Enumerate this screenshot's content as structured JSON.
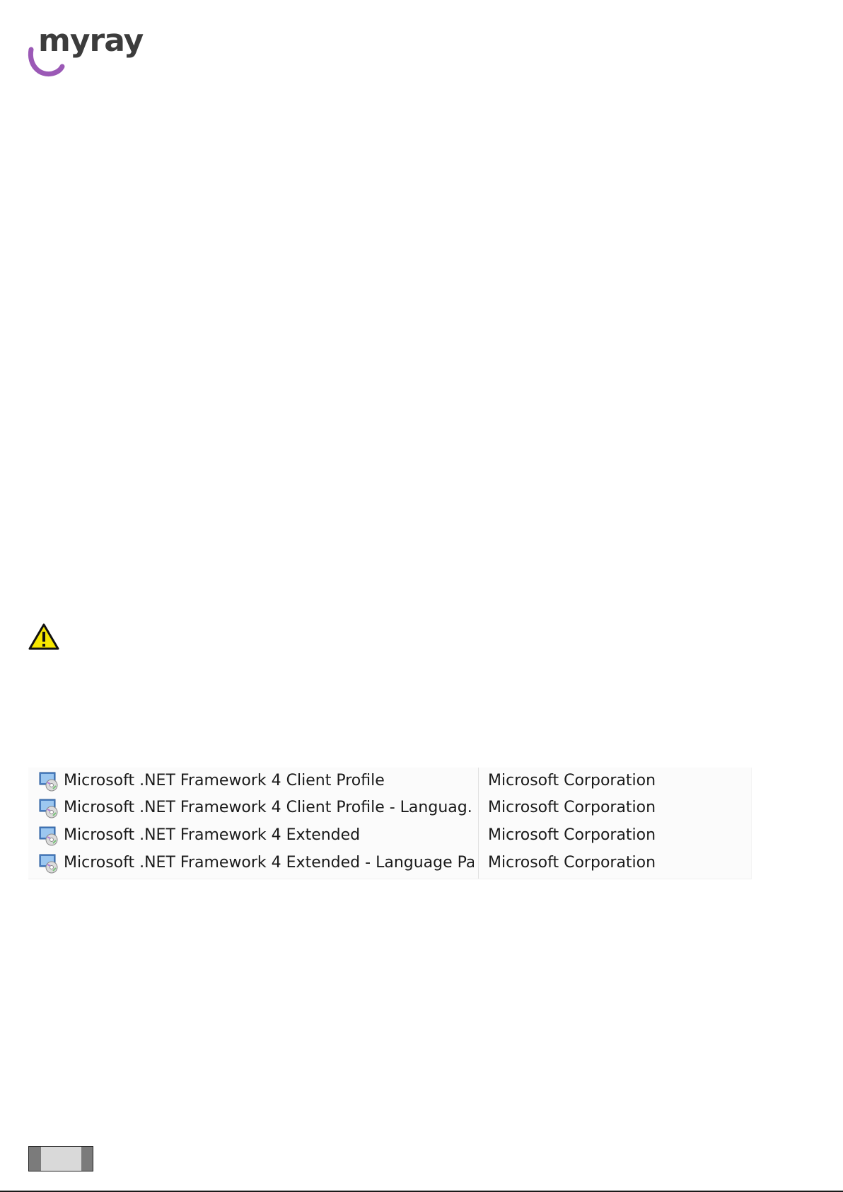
{
  "header": {
    "logo_text": "myray",
    "logo_color": "#9b59b6"
  },
  "warning": {
    "icon": "warning-triangle-icon",
    "fill_color": "#f5e600"
  },
  "installed_programs": [
    {
      "name": "Microsoft .NET Framework 4 Client Profile",
      "publisher": "Microsoft Corporation",
      "icon": "installer-cd-monitor-icon"
    },
    {
      "name": "Microsoft .NET Framework 4 Client Profile - Languag...",
      "publisher": "Microsoft Corporation",
      "icon": "installer-cd-monitor-icon"
    },
    {
      "name": "Microsoft .NET Framework 4 Extended",
      "publisher": "Microsoft Corporation",
      "icon": "installer-cd-monitor-icon"
    },
    {
      "name": "Microsoft .NET Framework 4 Extended - Language Pa...",
      "publisher": "Microsoft Corporation",
      "icon": "installer-cd-monitor-icon"
    }
  ],
  "footer": {
    "page_tab": "page-number-tab"
  }
}
